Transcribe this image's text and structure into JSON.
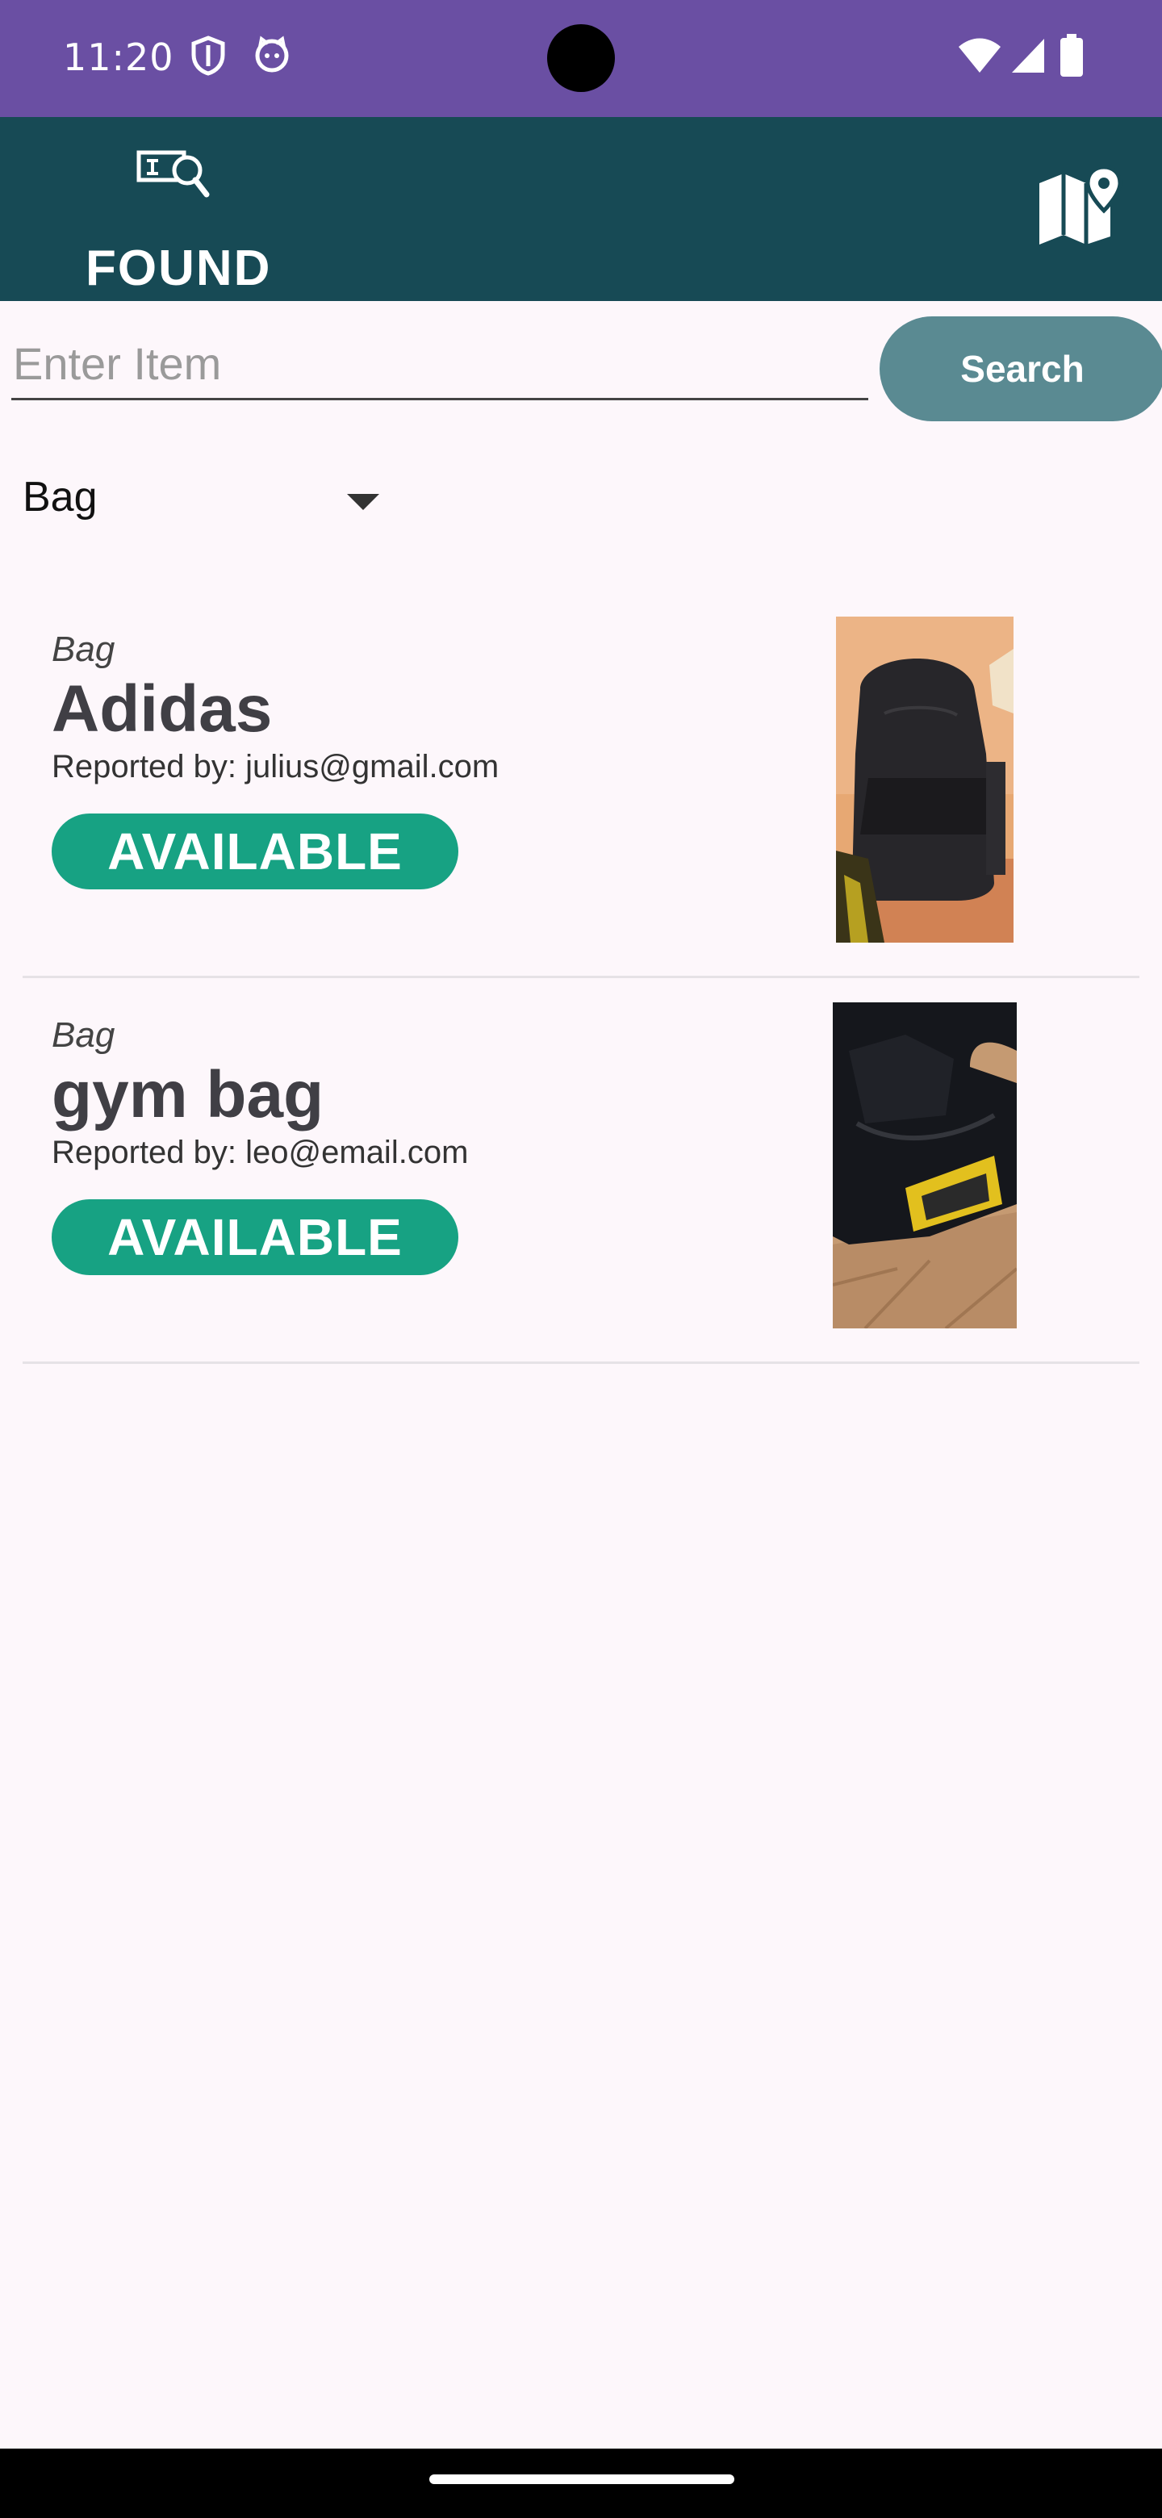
{
  "status_bar": {
    "time": "11:20",
    "left_icons": [
      "shield-icon",
      "cat-face-icon"
    ],
    "right_icons": [
      "wifi-icon",
      "signal-icon",
      "battery-icon"
    ],
    "color": "#6a4fa3"
  },
  "app_bar": {
    "logo_text": "FOUND",
    "logo_icon": "id-card-search-icon",
    "map_icon": "map-pin-icon",
    "color": "#174a55"
  },
  "search": {
    "placeholder": "Enter Item",
    "value": "",
    "button_label": "Search",
    "button_color": "#5a8a92"
  },
  "filter": {
    "selected": "Bag"
  },
  "items": [
    {
      "category": "Bag",
      "title": "Adidas",
      "reporter": "Reported by: julius@gmail.com",
      "status": "AVAILABLE",
      "image": "black backpack on floor"
    },
    {
      "category": "Bag",
      "title": "gym bag",
      "reporter": "Reported by: leo@email.com",
      "status": "AVAILABLE",
      "image": "black gym bag on parquet floor"
    }
  ],
  "status_color": "#17a283"
}
